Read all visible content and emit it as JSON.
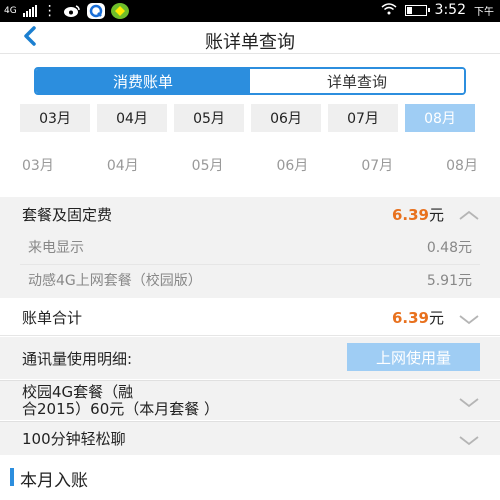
{
  "status_bar": {
    "network": "4G",
    "time": "3:52",
    "ampm": "下午"
  },
  "header": {
    "title": "账详单查询"
  },
  "tabs": [
    {
      "label": "消费账单",
      "active": true
    },
    {
      "label": "详单查询",
      "active": false
    }
  ],
  "months": [
    {
      "label": "03月",
      "active": false
    },
    {
      "label": "04月",
      "active": false
    },
    {
      "label": "05月",
      "active": false
    },
    {
      "label": "06月",
      "active": false
    },
    {
      "label": "07月",
      "active": false
    },
    {
      "label": "08月",
      "active": true
    }
  ],
  "month_labels": [
    "03月",
    "04月",
    "05月",
    "06月",
    "07月",
    "08月"
  ],
  "package_fees": {
    "label": "套餐及固定费",
    "amount": "6.39",
    "unit": "元",
    "items": [
      {
        "label": "来电显示",
        "amount": "0.48元"
      },
      {
        "label": "动感4G上网套餐（校园版）",
        "amount": "5.91元"
      }
    ]
  },
  "bill_total": {
    "label": "账单合计",
    "amount": "6.39",
    "unit": "元"
  },
  "usage_detail": {
    "label": "通讯量使用明细:",
    "button_label": "上网使用量"
  },
  "packages": [
    {
      "line1": "校园4G套餐（融",
      "line2": "合2015）60元（本月套餐 ）"
    },
    {
      "line1": "100分钟轻松聊",
      "line2": ""
    }
  ],
  "month_income": {
    "label": "本月入账"
  },
  "colors": {
    "accent": "#2c8ede",
    "amount": "#e8711e",
    "light_accent": "#9fcdf4"
  }
}
